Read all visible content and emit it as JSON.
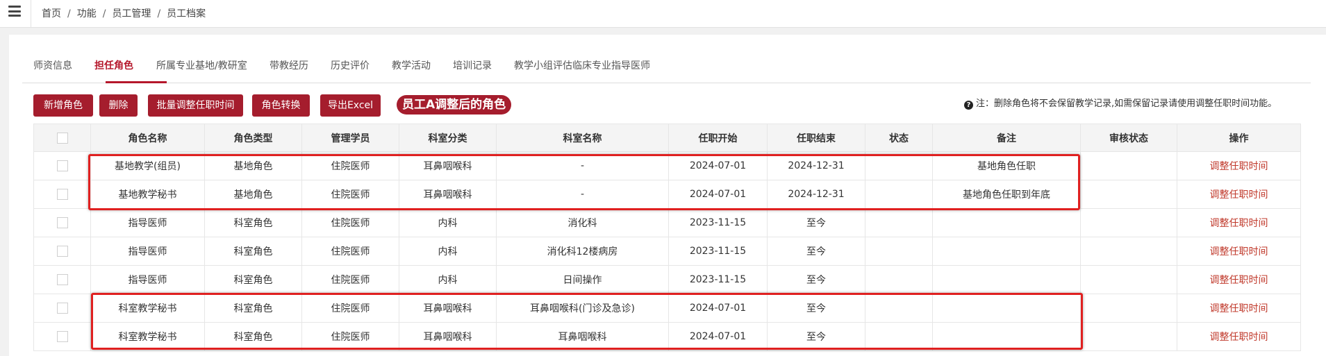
{
  "breadcrumb": [
    "首页",
    "功能",
    "员工管理",
    "员工档案"
  ],
  "tabs": [
    {
      "label": "师资信息"
    },
    {
      "label": "担任角色"
    },
    {
      "label": "所属专业基地/教研室"
    },
    {
      "label": "带教经历"
    },
    {
      "label": "历史评价"
    },
    {
      "label": "教学活动"
    },
    {
      "label": "培训记录"
    },
    {
      "label": "教学小组评估临床专业指导医师"
    }
  ],
  "active_tab": "担任角色",
  "toolbar": {
    "add_role": "新增角色",
    "delete": "删除",
    "batch_adjust": "批量调整任职时间",
    "role_convert": "角色转换",
    "export_excel": "导出Excel"
  },
  "annotation": "员工A调整后的角色",
  "note": "注：删除角色将不会保留教学记录,如需保留记录请使用调整任职时间功能。",
  "table": {
    "headers": [
      "角色名称",
      "角色类型",
      "管理学员",
      "科室分类",
      "科室名称",
      "任职开始",
      "任职结束",
      "状态",
      "备注",
      "审核状态",
      "操作"
    ],
    "rows": [
      [
        "基地教学(组员)",
        "基地角色",
        "住院医师",
        "耳鼻咽喉科",
        "-",
        "2024-07-01",
        "2024-12-31",
        "",
        "基地角色任职",
        "",
        "调整任职时间"
      ],
      [
        "基地教学秘书",
        "基地角色",
        "住院医师",
        "耳鼻咽喉科",
        "-",
        "2024-07-01",
        "2024-12-31",
        "",
        "基地角色任职到年底",
        "",
        "调整任职时间"
      ],
      [
        "指导医师",
        "科室角色",
        "住院医师",
        "内科",
        "消化科",
        "2023-11-15",
        "至今",
        "",
        "",
        "",
        "调整任职时间"
      ],
      [
        "指导医师",
        "科室角色",
        "住院医师",
        "内科",
        "消化科12楼病房",
        "2023-11-15",
        "至今",
        "",
        "",
        "",
        "调整任职时间"
      ],
      [
        "指导医师",
        "科室角色",
        "住院医师",
        "内科",
        "日间操作",
        "2023-11-15",
        "至今",
        "",
        "",
        "",
        "调整任职时间"
      ],
      [
        "科室教学秘书",
        "科室角色",
        "住院医师",
        "耳鼻咽喉科",
        "耳鼻咽喉科(门诊及急诊)",
        "2024-07-01",
        "至今",
        "",
        "",
        "",
        "调整任职时间"
      ],
      [
        "科室教学秘书",
        "科室角色",
        "住院医师",
        "耳鼻咽喉科",
        "耳鼻咽喉科",
        "2024-07-01",
        "至今",
        "",
        "",
        "",
        "调整任职时间"
      ]
    ]
  },
  "colors": {
    "accent": "#a51d2d",
    "link": "#c0392b",
    "highlight": "#e02020"
  }
}
